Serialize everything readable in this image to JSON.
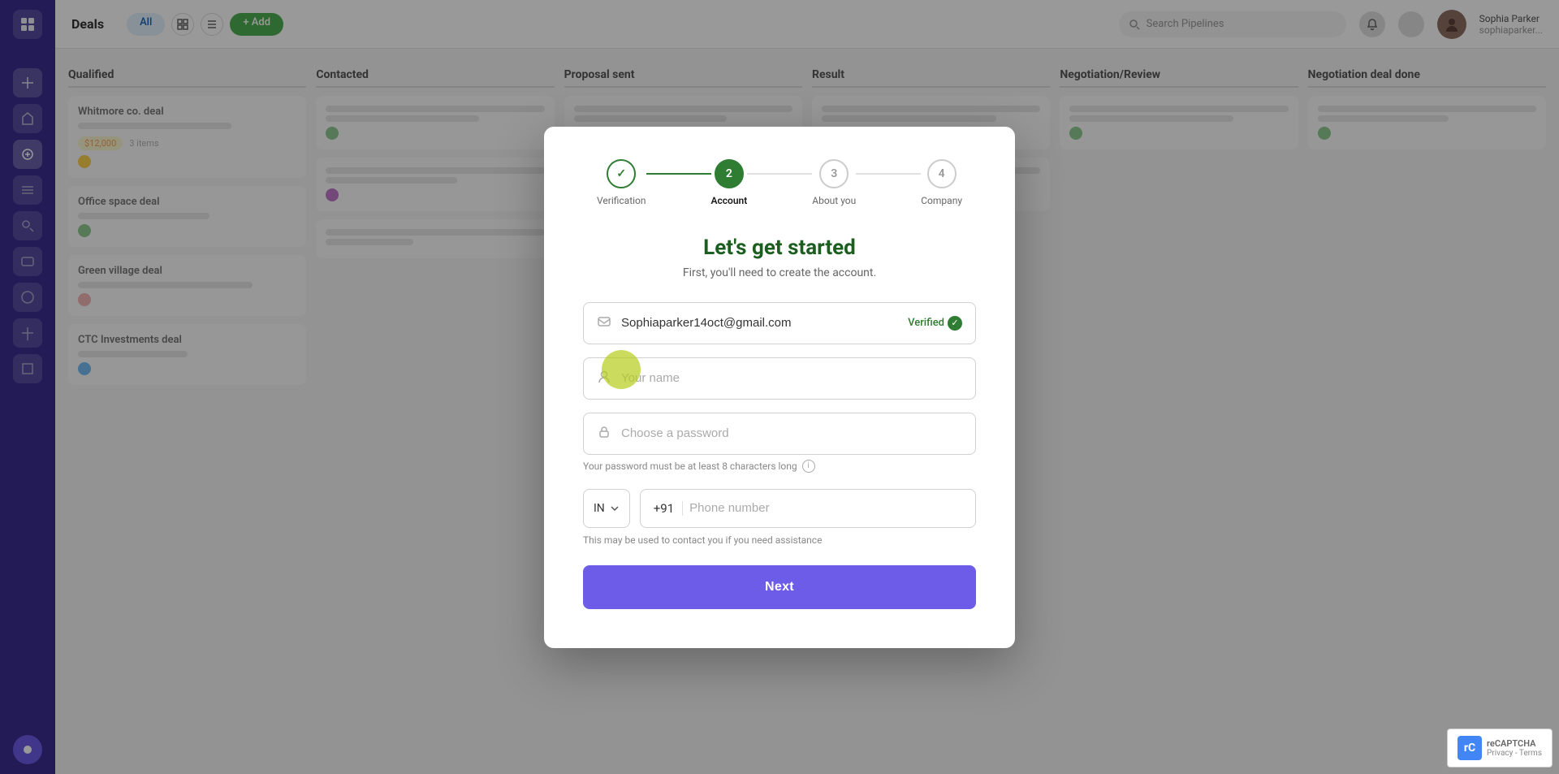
{
  "app": {
    "title": "Deals"
  },
  "sidebar": {
    "icons": [
      "⊞",
      "◈",
      "◎",
      "◉",
      "✦",
      "◆",
      "⬟",
      "◐",
      "◑",
      "◒"
    ]
  },
  "modal": {
    "title": "Let's get started",
    "subtitle": "First, you'll need to create the account.",
    "stepper": {
      "steps": [
        {
          "number": "✓",
          "label": "Verification",
          "state": "completed"
        },
        {
          "number": "2",
          "label": "Account",
          "state": "active"
        },
        {
          "number": "3",
          "label": "About you",
          "state": "inactive"
        },
        {
          "number": "4",
          "label": "Company",
          "state": "inactive"
        }
      ]
    },
    "email_field": {
      "value": "Sophiaparker14oct@gmail.com",
      "verified_text": "Verified"
    },
    "name_field": {
      "placeholder": "Your name"
    },
    "password_field": {
      "placeholder": "Choose a password",
      "hint": "Your password must be at least 8 characters long"
    },
    "phone": {
      "country_code": "IN",
      "prefix": "+91",
      "placeholder": "Phone number",
      "hint": "This may be used to contact you if you need assistance"
    },
    "next_button": "Next"
  },
  "captcha": {
    "line1": "reCAPTCHA",
    "line2": "Privacy - Terms"
  }
}
